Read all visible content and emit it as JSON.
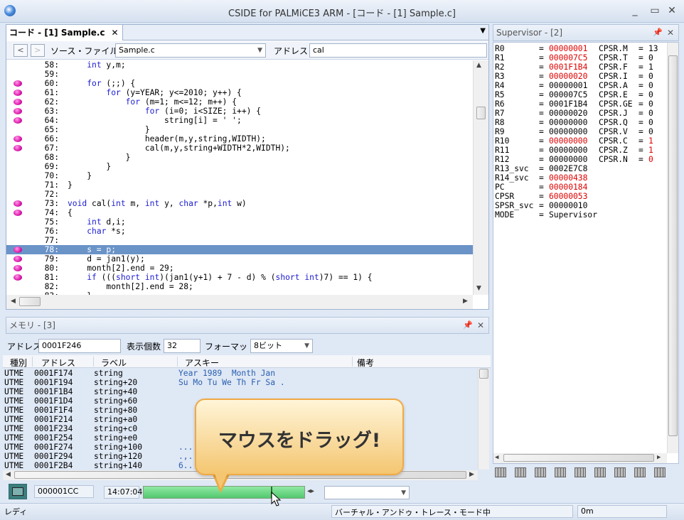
{
  "window": {
    "title": "CSIDE for PALMiCE3 ARM - [コード - [1] Sample.c]"
  },
  "code_panel": {
    "tab_label": "コード - [1] Sample.c",
    "source_file_label": "ソース・ファイル",
    "source_file_value": "Sample.c",
    "address_label": "アドレス",
    "address_value": "cal",
    "lines": [
      {
        "n": "58:",
        "t": "    int y,m;",
        "bp": false
      },
      {
        "n": "59:",
        "t": "",
        "bp": false
      },
      {
        "n": "60:",
        "t": "    for (;;) {",
        "bp": true
      },
      {
        "n": "61:",
        "t": "        for (y=YEAR; y<=2010; y++) {",
        "bp": true
      },
      {
        "n": "62:",
        "t": "            for (m=1; m<=12; m++) {",
        "bp": true
      },
      {
        "n": "63:",
        "t": "                for (i=0; i<SIZE; i++) {",
        "bp": true
      },
      {
        "n": "64:",
        "t": "                    string[i] = ' ';",
        "bp": true
      },
      {
        "n": "65:",
        "t": "                }",
        "bp": false
      },
      {
        "n": "66:",
        "t": "                header(m,y,string,WIDTH);",
        "bp": true
      },
      {
        "n": "67:",
        "t": "                cal(m,y,string+WIDTH*2,WIDTH);",
        "bp": true
      },
      {
        "n": "68:",
        "t": "            }",
        "bp": false
      },
      {
        "n": "69:",
        "t": "        }",
        "bp": false
      },
      {
        "n": "70:",
        "t": "    }",
        "bp": false
      },
      {
        "n": "71:",
        "t": "}",
        "bp": false
      },
      {
        "n": "72:",
        "t": "",
        "bp": false
      },
      {
        "n": "73:",
        "t": "void cal(int m, int y, char *p,int w)",
        "bp": true
      },
      {
        "n": "74:",
        "t": "{",
        "bp": true
      },
      {
        "n": "75:",
        "t": "    int d,i;",
        "bp": false
      },
      {
        "n": "76:",
        "t": "    char *s;",
        "bp": false
      },
      {
        "n": "77:",
        "t": "",
        "bp": false
      },
      {
        "n": "78:",
        "t": "    s = p;",
        "bp": true,
        "hl": true
      },
      {
        "n": "79:",
        "t": "    d = jan1(y);",
        "bp": true
      },
      {
        "n": "80:",
        "t": "    month[2].end = 29;",
        "bp": true
      },
      {
        "n": "81:",
        "t": "    if (((short int)(jan1(y+1) + 7 - d) % (short int)7) == 1) {",
        "bp": true
      },
      {
        "n": "82:",
        "t": "        month[2].end = 28;",
        "bp": false
      },
      {
        "n": "83:",
        "t": "    }",
        "bp": false
      }
    ]
  },
  "memory_panel": {
    "title": "メモリ - [3]",
    "address_label": "アドレス",
    "address_value": "0001F246",
    "count_label": "表示個数",
    "count_value": "32",
    "format_label": "フォーマット",
    "format_value": "8ビット",
    "columns": [
      "種別",
      "アドレス",
      "ラベル",
      "アスキー",
      "備考"
    ],
    "rows": [
      [
        "UTME",
        "0001F174",
        "string",
        "Year 1989  Month Jan"
      ],
      [
        "UTME",
        "0001F194",
        "string+20",
        "Su Mo Tu We Th Fr Sa ."
      ],
      [
        "UTME",
        "0001F1B4",
        "string+40",
        ""
      ],
      [
        "UTME",
        "0001F1D4",
        "string+60",
        ""
      ],
      [
        "UTME",
        "0001F1F4",
        "string+80",
        ""
      ],
      [
        "UTME",
        "0001F214",
        "string+a0",
        ""
      ],
      [
        "UTME",
        "0001F234",
        "string+c0",
        ""
      ],
      [
        "UTME",
        "0001F254",
        "string+e0",
        ""
      ],
      [
        "UTME",
        "0001F274",
        "string+100",
        "..."
      ],
      [
        "UTME",
        "0001F294",
        "string+120",
        ".,."
      ],
      [
        "UTME",
        "0001F2B4",
        "string+140",
        "6.."
      ]
    ]
  },
  "supervisor_panel": {
    "title": "Supervisor - [2]",
    "registers": [
      {
        "name": "R0",
        "val": "00000001",
        "red": true,
        "flag": "CPSR.M",
        "fval": "13",
        "fred": false
      },
      {
        "name": "R1",
        "val": "000007C5",
        "red": true,
        "flag": "CPSR.T",
        "fval": "0",
        "fred": false
      },
      {
        "name": "R2",
        "val": "0001F1B4",
        "red": true,
        "flag": "CPSR.F",
        "fval": "1",
        "fred": false
      },
      {
        "name": "R3",
        "val": "00000020",
        "red": true,
        "flag": "CPSR.I",
        "fval": "0",
        "fred": false
      },
      {
        "name": "R4",
        "val": "00000001",
        "red": false,
        "flag": "CPSR.A",
        "fval": "0",
        "fred": false
      },
      {
        "name": "R5",
        "val": "000007C5",
        "red": false,
        "flag": "CPSR.E",
        "fval": "0",
        "fred": false
      },
      {
        "name": "R6",
        "val": "0001F1B4",
        "red": false,
        "flag": "CPSR.GE",
        "fval": "0",
        "fred": false
      },
      {
        "name": "R7",
        "val": "00000020",
        "red": false,
        "flag": "CPSR.J",
        "fval": "0",
        "fred": false
      },
      {
        "name": "R8",
        "val": "00000000",
        "red": false,
        "flag": "CPSR.Q",
        "fval": "0",
        "fred": false
      },
      {
        "name": "R9",
        "val": "00000000",
        "red": false,
        "flag": "CPSR.V",
        "fval": "0",
        "fred": false
      },
      {
        "name": "R10",
        "val": "00000000",
        "red": true,
        "flag": "CPSR.C",
        "fval": "1",
        "fred": true
      },
      {
        "name": "R11",
        "val": "00000000",
        "red": false,
        "flag": "CPSR.Z",
        "fval": "1",
        "fred": true
      },
      {
        "name": "R12",
        "val": "00000000",
        "red": false,
        "flag": "CPSR.N",
        "fval": "0",
        "fred": true
      },
      {
        "name": "R13_svc",
        "val": "0002E7C8",
        "red": false,
        "flag": "",
        "fval": "",
        "fred": false
      },
      {
        "name": "R14_svc",
        "val": "00000438",
        "red": true,
        "flag": "",
        "fval": "",
        "fred": false
      },
      {
        "name": "PC",
        "val": "00000184",
        "red": true,
        "flag": "",
        "fval": "",
        "fred": false
      },
      {
        "name": "CPSR",
        "val": "60000053",
        "red": true,
        "flag": "",
        "fval": "",
        "fred": false
      },
      {
        "name": "SPSR_svc",
        "val": "00000010",
        "red": false,
        "flag": "",
        "fval": "",
        "fred": false
      },
      {
        "name": "MODE",
        "val": "Supervisor",
        "red": false,
        "flag": "",
        "fval": "",
        "fred": false
      }
    ]
  },
  "bottom_toolbar": {
    "counter": "000001CC",
    "time": "14:07:04",
    "progress": 0.79
  },
  "status_bar": {
    "ready": "レディ",
    "mode": "バーチャル・アンドゥ・トレース・モード中",
    "right": "0m"
  },
  "callout": {
    "text": "マウスをドラッグ!"
  },
  "colors": {
    "highlight": "#6a93c8",
    "keyword": "#1b1bd1",
    "changed": "#e00000",
    "breakpoint": "#e020b0"
  }
}
